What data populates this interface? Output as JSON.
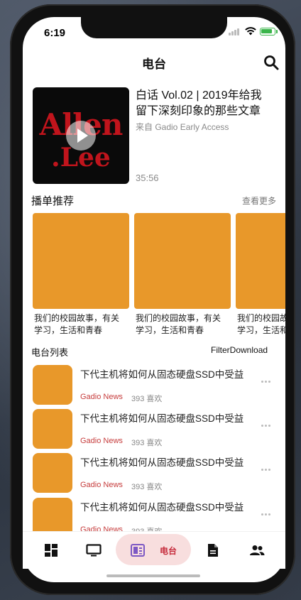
{
  "status": {
    "time": "6:19"
  },
  "header": {
    "title": "电台"
  },
  "featured": {
    "art_line1": "Allen",
    "art_line2": ".Lee",
    "title": "白话 Vol.02 | 2019年给我留下深刻印象的那些文章",
    "source": "来自 Gadio Early Access",
    "duration": "35:56"
  },
  "playlists": {
    "title": "播单推荐",
    "more": "查看更多",
    "items": [
      {
        "caption": "我们的校园故事，有关\n学习，生活和青春"
      },
      {
        "caption": "我们的校园故事，有关\n学习，生活和青春"
      },
      {
        "caption": "我们的校园故事，有关\n学习，生活和青春"
      }
    ]
  },
  "radio_list": {
    "title": "电台列表",
    "filter": "Filter",
    "download": "Download",
    "items": [
      {
        "title": "下代主机将如何从固态硬盘SSD中受益",
        "tag": "Gadio News",
        "likes": "393 喜欢"
      },
      {
        "title": "下代主机将如何从固态硬盘SSD中受益",
        "tag": "Gadio News",
        "likes": "393 喜欢"
      },
      {
        "title": "下代主机将如何从固态硬盘SSD中受益",
        "tag": "Gadio News",
        "likes": "393 喜欢"
      },
      {
        "title": "下代主机将如何从固态硬盘SSD中受益",
        "tag": "Gadio News",
        "likes": "393 喜欢"
      }
    ]
  },
  "tabbar": {
    "active_label": "电台",
    "icons": [
      "dashboard-icon",
      "tv-icon",
      "radio-icon",
      "article-icon",
      "people-icon"
    ]
  },
  "colors": {
    "accent": "#c62b3b",
    "thumb": "#e8982a",
    "active_bg": "#f8dede"
  }
}
